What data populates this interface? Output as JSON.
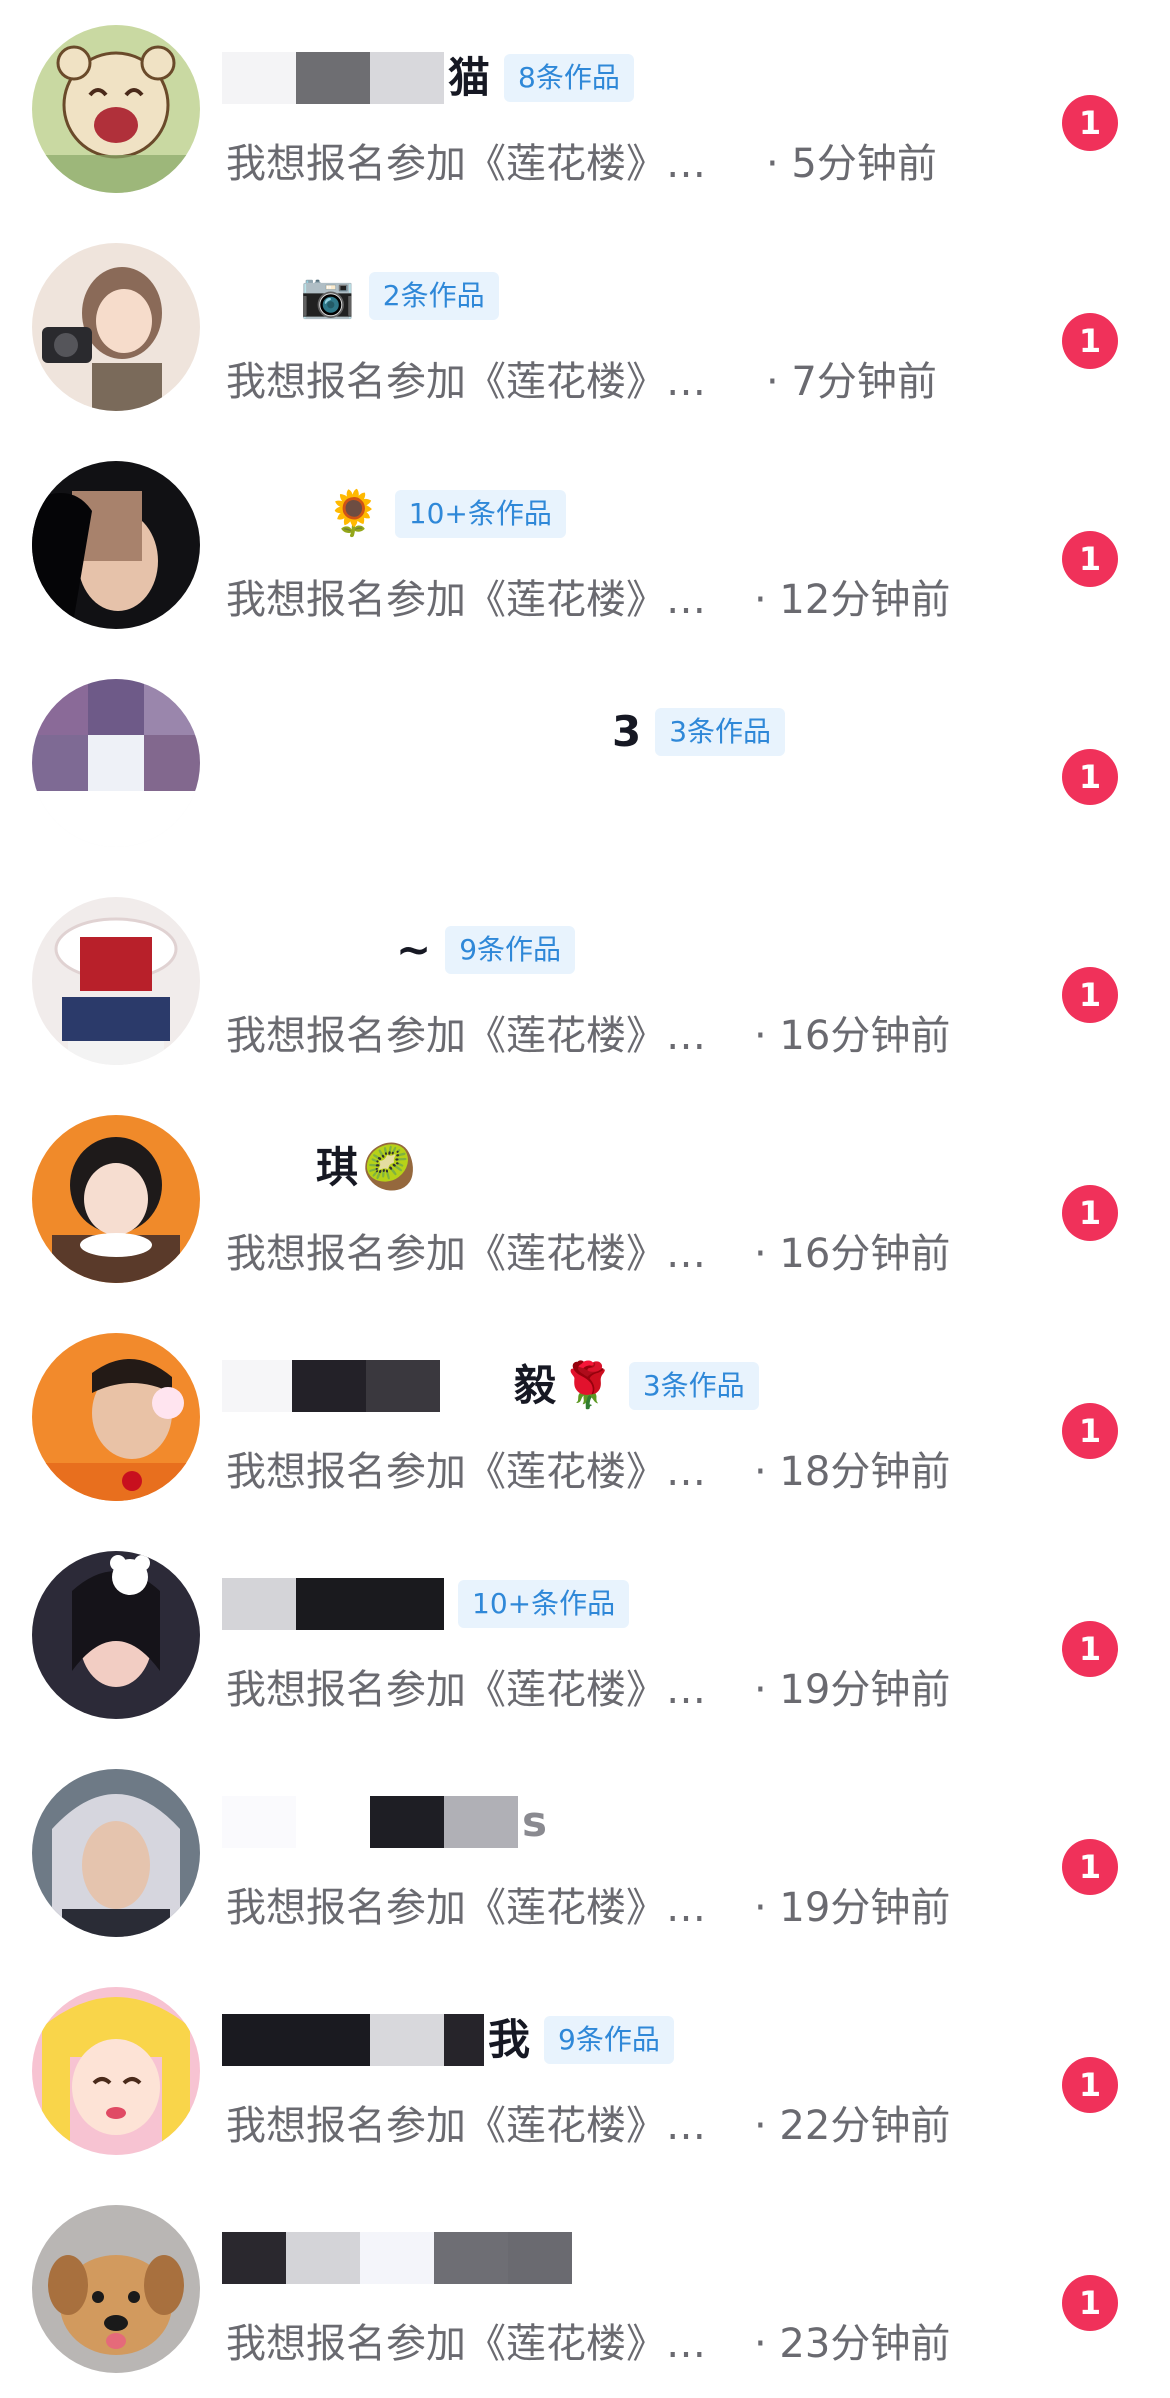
{
  "colors": {
    "badge_bg": "#e8f3fd",
    "badge_text": "#2f88d8",
    "unread": "#f0315a",
    "message_text": "#6a6a70"
  },
  "conversations": [
    {
      "name_tail": "猫",
      "emoji": "",
      "badge": "8条作品",
      "message": "我想报名参加《莲花楼》…",
      "time": "· 5分钟前",
      "unread": "1",
      "avatar_icon": "cartoon-bear-avatar"
    },
    {
      "name_tail": "",
      "emoji": "📷",
      "badge": "2条作品",
      "message": "我想报名参加《莲花楼》…",
      "time": "· 7分钟前",
      "unread": "1",
      "avatar_icon": "girl-with-camera-avatar"
    },
    {
      "name_tail": "",
      "emoji": "🌻",
      "badge": "10+条作品",
      "message": "我想报名参加《莲花楼》…",
      "time": "· 12分钟前",
      "unread": "1",
      "avatar_icon": "girl-photo-avatar"
    },
    {
      "name_tail": "3",
      "emoji": "",
      "badge": "3条作品",
      "message": "",
      "time": "",
      "unread": "1",
      "avatar_icon": "pixelated-avatar"
    },
    {
      "name_tail": "~",
      "emoji": "",
      "badge": "9条作品",
      "message": "我想报名参加《莲花楼》…",
      "time": "· 16分钟前",
      "unread": "1",
      "avatar_icon": "maid-avatar"
    },
    {
      "name_tail": "琪",
      "emoji": "🥝",
      "badge": "",
      "message": "我想报名参加《莲花楼》…",
      "time": "· 16分钟前",
      "unread": "1",
      "avatar_icon": "child-photo-avatar"
    },
    {
      "name_tail": "毅",
      "emoji": "🌹",
      "badge": "3条作品",
      "message": "我想报名参加《莲花楼》…",
      "time": "· 18分钟前",
      "unread": "1",
      "avatar_icon": "man-with-rose-avatar"
    },
    {
      "name_tail": "",
      "emoji": "",
      "badge": "10+条作品",
      "message": "我想报名参加《莲花楼》…",
      "time": "· 19分钟前",
      "unread": "1",
      "avatar_icon": "girl-with-bear-avatar"
    },
    {
      "name_tail": "s",
      "emoji": "",
      "badge": "",
      "message": "我想报名参加《莲花楼》…",
      "time": "· 19分钟前",
      "unread": "1",
      "avatar_icon": "costume-man-avatar"
    },
    {
      "name_tail": "我",
      "emoji": "",
      "badge": "9条作品",
      "message": "我想报名参加《莲花楼》…",
      "time": "· 22分钟前",
      "unread": "1",
      "avatar_icon": "anime-girl-avatar"
    },
    {
      "name_tail": "",
      "emoji": "",
      "badge": "",
      "message": "我想报名参加《莲花楼》…",
      "time": "· 23分钟前",
      "unread": "1",
      "avatar_icon": "puppy-avatar"
    }
  ]
}
